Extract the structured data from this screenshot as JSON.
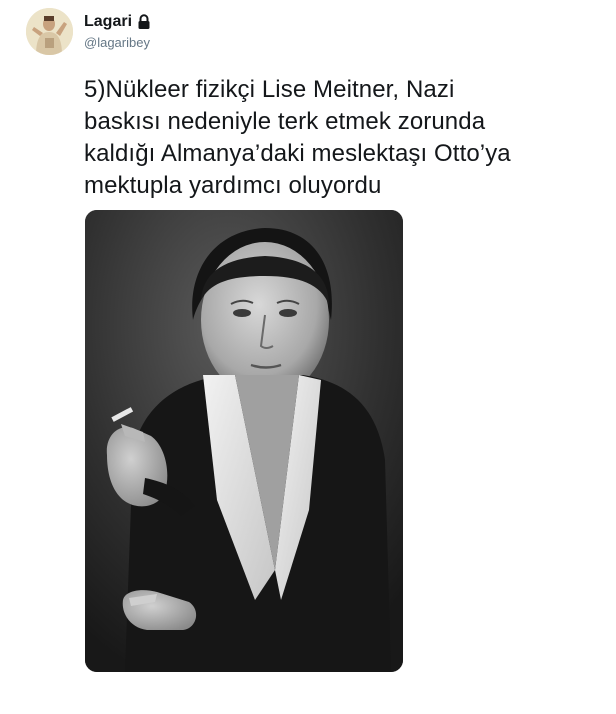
{
  "tweet": {
    "author": {
      "display_name": "Lagari",
      "handle": "@lagaribey",
      "verified_icon": "lock-icon"
    },
    "text": "5)Nükleer fizikçi Lise Meitner, Nazi\nbaskısı nedeniyle terk etmek zorunda\nkaldığı Almanya’daki meslektaşı Otto’ya\nmektupla yardımcı oluyordu",
    "media": {
      "type": "black-and-white photograph",
      "icon": "photo"
    }
  },
  "colors": {
    "text": "#14171a",
    "handle": "#657786",
    "background": "#ffffff"
  }
}
